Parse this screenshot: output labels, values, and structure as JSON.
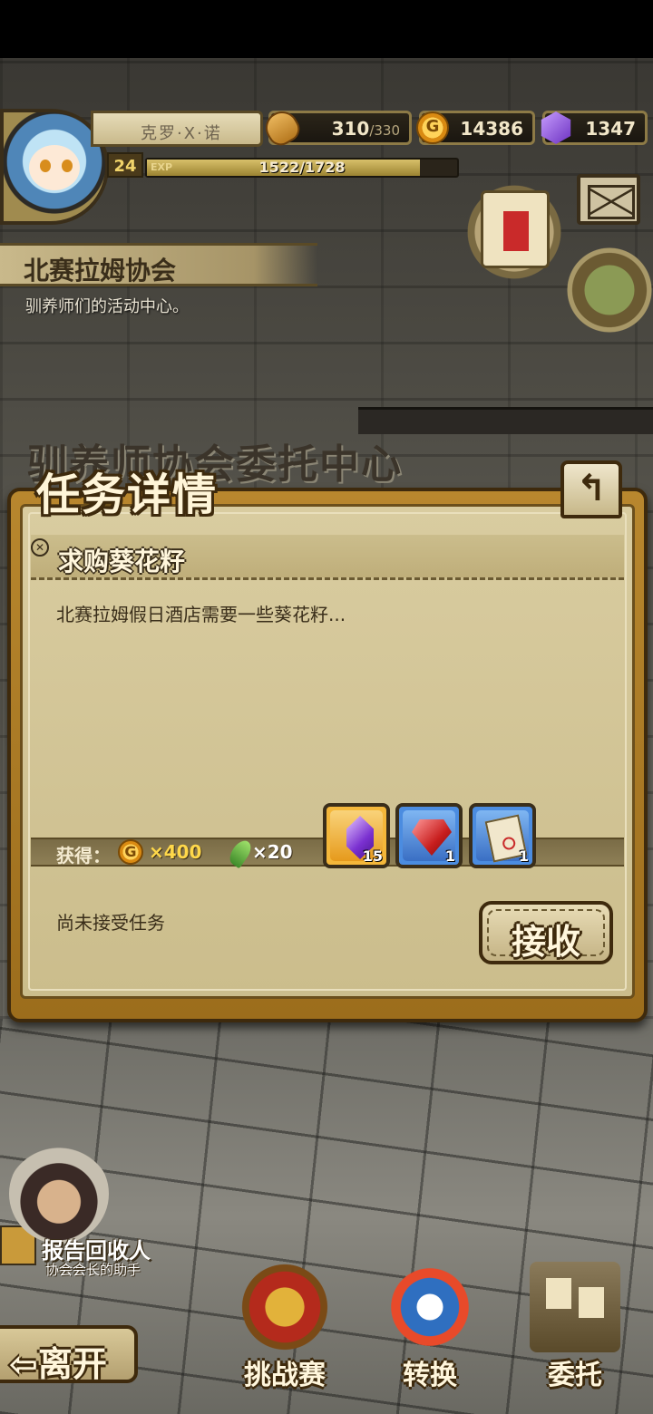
{
  "player": {
    "name": "克罗·X·诺",
    "level": "24",
    "exp_label": "EXP",
    "exp_text": "1522/1728",
    "exp_fraction": 0.88
  },
  "resources": {
    "stamina_value": "310",
    "stamina_max": "/330",
    "gold": "14386",
    "gems": "1347"
  },
  "location": {
    "name": "北赛拉姆协会",
    "subtitle": "驯养师们的活动中心。",
    "center_title": "驯养师协会委托中心"
  },
  "dialog": {
    "title": "任务详情",
    "back_symbol": "↰",
    "task_name": "求购葵花籽",
    "task_description": "北赛拉姆假日酒店需要一些葵花籽...",
    "reward_label": "获得：",
    "coin_symbol": "G",
    "gold_reward": "×400",
    "feather_reward": "×20",
    "items": [
      {
        "type": "purple-gem",
        "count": "15"
      },
      {
        "type": "ruby-shard",
        "count": "1"
      },
      {
        "type": "scroll",
        "count": "1"
      }
    ],
    "status": "尚未接受任务",
    "accept_label": "接收"
  },
  "npc": {
    "name": "报告回收人",
    "title": "协会会长的助手"
  },
  "nav": {
    "leave_label": "⇦离开",
    "items": [
      {
        "label": "挑战赛"
      },
      {
        "label": "转换"
      },
      {
        "label": "委托"
      }
    ]
  },
  "colors": {
    "dialog_frame": "#b8872e",
    "parchment": "#d9cca0",
    "gold_text": "#ffd84a",
    "slot_orange": "#f4b73a",
    "slot_blue": "#4b8ce0"
  }
}
